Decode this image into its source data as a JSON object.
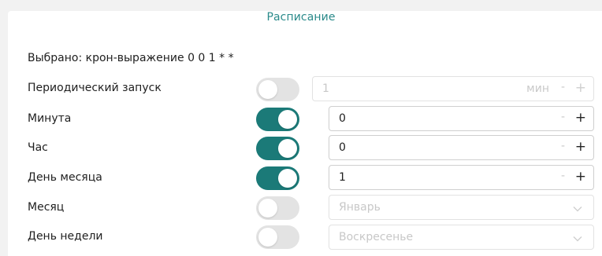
{
  "header": {
    "title": "Расписание"
  },
  "selected_text": "Выбрано: крон-выражение 0 0 1 * *",
  "rows": {
    "periodic": {
      "label": "Периодический запуск",
      "enabled": false,
      "value": "1",
      "unit": "мин",
      "minus": "-",
      "plus": "+"
    },
    "minute": {
      "label": "Минута",
      "enabled": true,
      "value": "0",
      "minus": "-",
      "plus": "+"
    },
    "hour": {
      "label": "Час",
      "enabled": true,
      "value": "0",
      "minus": "-",
      "plus": "+"
    },
    "day_of_month": {
      "label": "День месяца",
      "enabled": true,
      "value": "1",
      "minus": "-",
      "plus": "+"
    },
    "month": {
      "label": "Месяц",
      "enabled": false,
      "value": "Январь"
    },
    "day_of_week": {
      "label": "День недели",
      "enabled": false,
      "value": "Воскресенье"
    }
  },
  "colors": {
    "accent": "#1b7a78",
    "title": "#2a8a8a",
    "toggle_off": "#e3e3e3"
  },
  "icons": {
    "dropdown": "chevron-down-icon"
  }
}
